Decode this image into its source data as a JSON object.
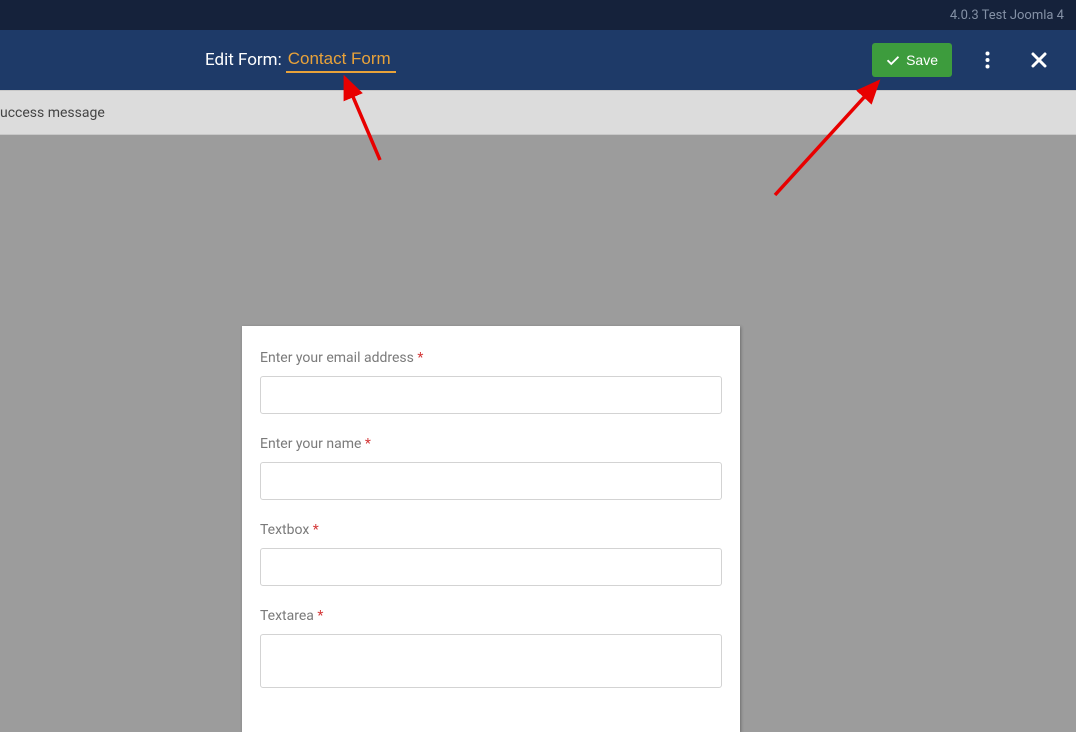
{
  "topbar": {
    "label": "4.0.3 Test Joomla 4"
  },
  "header": {
    "title_label": "Edit Form:",
    "title_value": "Contact Form",
    "save_label": "Save"
  },
  "subbar": {
    "text": "uccess message"
  },
  "form": {
    "fields": [
      {
        "label": "Enter your email address",
        "required": true,
        "type": "text"
      },
      {
        "label": "Enter your name",
        "required": true,
        "type": "text"
      },
      {
        "label": "Textbox",
        "required": true,
        "type": "text"
      },
      {
        "label": "Textarea",
        "required": true,
        "type": "textarea"
      }
    ],
    "required_mark": "*"
  }
}
